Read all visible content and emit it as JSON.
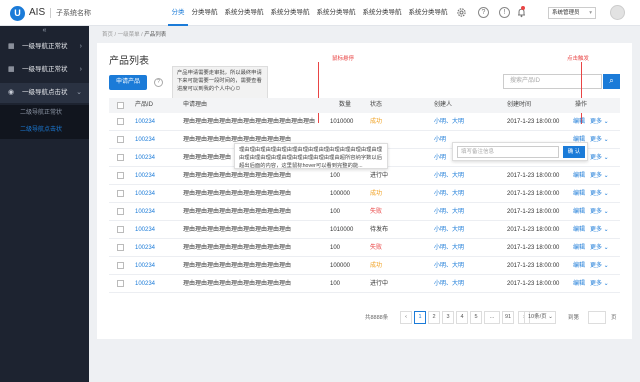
{
  "header": {
    "logo_mark": "U",
    "logo_text": "AIS",
    "system_name": "子系统名称",
    "nav": [
      "分类",
      "分类导航",
      "系统分类导航",
      "系统分类导航",
      "系统分类导航",
      "系统分类导航",
      "系统分类导航"
    ],
    "active_nav": 0,
    "role": "系统管理员",
    "role_caret": "▾",
    "icons": [
      "gear-icon",
      "help-icon",
      "info-icon",
      "bell-icon"
    ]
  },
  "sidebar": {
    "collapse_glyph": "«",
    "items": [
      {
        "label": "一级导航正常状",
        "icon": "grid-icon",
        "chevron": "›"
      },
      {
        "label": "一级导航正常状",
        "icon": "grid-icon",
        "chevron": "›"
      },
      {
        "label": "一级导航点击状",
        "icon": "circle-icon",
        "chevron": "⌄"
      }
    ],
    "subitems": [
      {
        "label": "二级导航正常状"
      },
      {
        "label": "二级导航点击状"
      }
    ]
  },
  "breadcrumb": {
    "a": "首页",
    "b": "一级菜单",
    "c": "产品列表",
    "sep": "/"
  },
  "page": {
    "title": "产品列表",
    "apply_button": "申请产品",
    "help_glyph": "?",
    "tooltip": "产品申请需要走审批，所以最终申请下来可能需要一段时间的，需要查看进度可以到我的个人中心⊙",
    "search_placeholder": "搜索产品ID",
    "search_glyph": "⌕"
  },
  "annotations": {
    "hover": "鼠标悬停",
    "click": "点击触发"
  },
  "table": {
    "headers": {
      "id": "产品ID",
      "reason": "申请理由",
      "qty": "数量",
      "status": "状态",
      "creator": "创建人",
      "time": "创建时间",
      "ops": "操作"
    },
    "rows": [
      {
        "id": "100234",
        "reason": "理由理由理由理由理由理由理由理由理由理由理由",
        "qty": "1010000",
        "status": "成功",
        "status_type": "ok",
        "creator": "小明、大明",
        "time": "2017-1-23 18:00:00"
      },
      {
        "id": "100234",
        "reason": "理由理由理由理由理由理由理由理由理由",
        "qty": "",
        "status": "",
        "status_type": "norm",
        "creator": "小明",
        "time": ""
      },
      {
        "id": "100234",
        "reason": "理由理由理由理由",
        "qty": "",
        "status": "",
        "status_type": "norm",
        "creator": "小明",
        "time": ""
      },
      {
        "id": "100234",
        "reason": "理由理由理由理由理由理由理由理由理由",
        "qty": "100",
        "status": "进行中",
        "status_type": "norm",
        "creator": "小明、大明",
        "time": "2017-1-23 18:00:00"
      },
      {
        "id": "100234",
        "reason": "理由理由理由理由理由理由理由理由理由",
        "qty": "100000",
        "status": "成功",
        "status_type": "ok",
        "creator": "小明、大明",
        "time": "2017-1-23 18:00:00"
      },
      {
        "id": "100234",
        "reason": "理由理由理由理由理由理由理由理由理由",
        "qty": "100",
        "status": "失败",
        "status_type": "fail",
        "creator": "小明、大明",
        "time": "2017-1-23 18:00:00"
      },
      {
        "id": "100234",
        "reason": "理由理由理由理由理由理由理由理由理由",
        "qty": "1010000",
        "status": "待发布",
        "status_type": "norm",
        "creator": "小明、大明",
        "time": "2017-1-23 18:00:00"
      },
      {
        "id": "100234",
        "reason": "理由理由理由理由理由理由理由理由理由",
        "qty": "100",
        "status": "失败",
        "status_type": "fail",
        "creator": "小明、大明",
        "time": "2017-1-23 18:00:00"
      },
      {
        "id": "100234",
        "reason": "理由理由理由理由理由理由理由理由理由",
        "qty": "100000",
        "status": "成功",
        "status_type": "ok",
        "creator": "小明、大明",
        "time": "2017-1-23 18:00:00"
      },
      {
        "id": "100234",
        "reason": "理由理由理由理由理由理由理由理由理由",
        "qty": "100",
        "status": "进行中",
        "status_type": "norm",
        "creator": "小明、大明",
        "time": "2017-1-23 18:00:00"
      }
    ],
    "op_edit": "编辑",
    "op_more": "更多 ⌄"
  },
  "hover_tip": "理由理由理由理由理由理由理由理由理由理由理由理由理由理由理由理由理由理由理由理由理由理由理由超所容纳字数以后超出后面的内容，这里鼠标hover可以看到完整的能...",
  "popover": {
    "placeholder": "填写备注信息",
    "confirm": "确 认"
  },
  "pagination": {
    "total": "共8888条",
    "prev": "‹",
    "pages": [
      "1",
      "2",
      "3",
      "4",
      "5",
      "...",
      "91"
    ],
    "active_page": 0,
    "next": "›",
    "page_size": "10条/页",
    "page_size_caret": "⌄",
    "jump_label": "到第",
    "jump_end": "页"
  }
}
